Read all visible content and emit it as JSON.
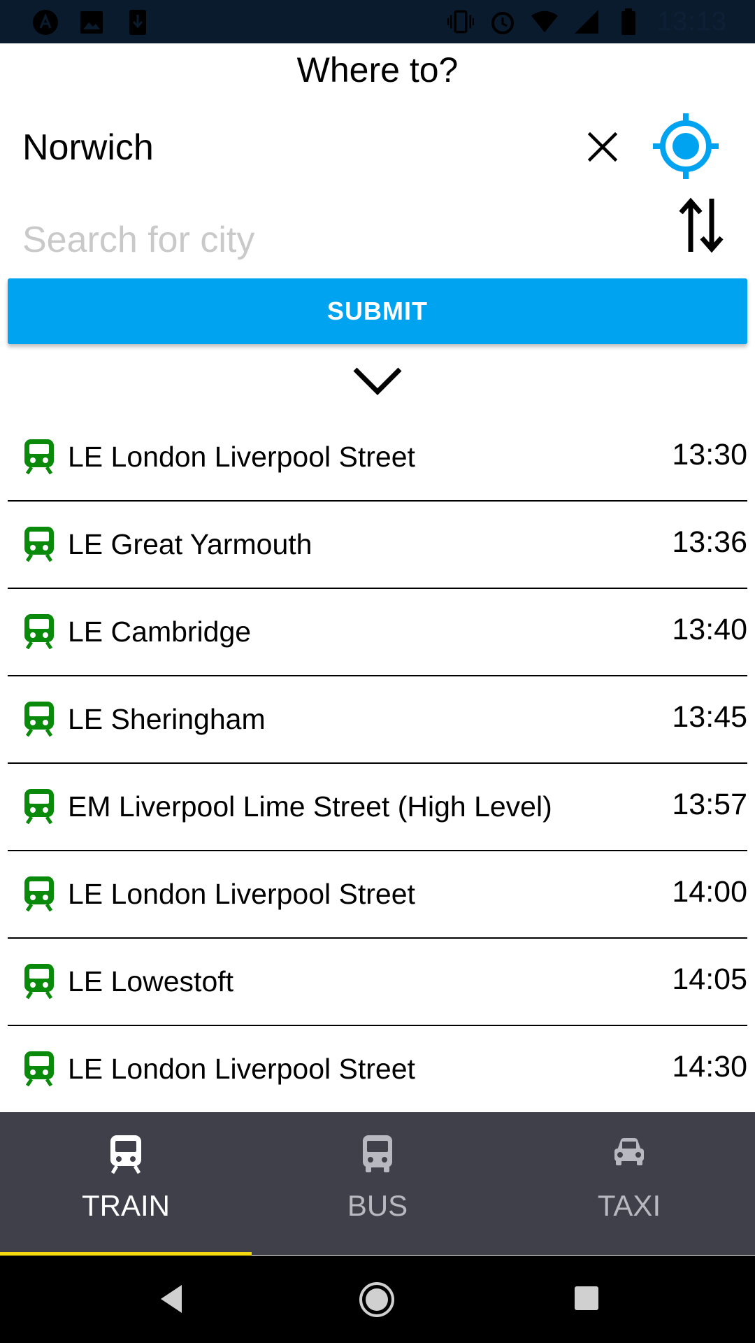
{
  "status_bar": {
    "time": "13:13",
    "left_icons": [
      "app-a-icon",
      "image-icon",
      "download-icon"
    ],
    "right_icons": [
      "vibrate-icon",
      "alarm-icon",
      "wifi-icon",
      "signal-icon",
      "battery-icon"
    ]
  },
  "header": {
    "title": "Where to?",
    "from_value": "Norwich",
    "to_placeholder": "Search for city",
    "submit_label": "SUBMIT"
  },
  "departures": [
    {
      "operator": "LE",
      "destination": "LE London Liverpool Street",
      "time": "13:30"
    },
    {
      "operator": "LE",
      "destination": "LE Great Yarmouth",
      "time": "13:36"
    },
    {
      "operator": "LE",
      "destination": "LE Cambridge",
      "time": "13:40"
    },
    {
      "operator": "LE",
      "destination": "LE Sheringham",
      "time": "13:45"
    },
    {
      "operator": "EM",
      "destination": "EM Liverpool Lime Street (High Level)",
      "time": "13:57"
    },
    {
      "operator": "LE",
      "destination": "LE London Liverpool Street",
      "time": "14:00"
    },
    {
      "operator": "LE",
      "destination": "LE Lowestoft",
      "time": "14:05"
    },
    {
      "operator": "LE",
      "destination": "LE London Liverpool Street",
      "time": "14:30"
    }
  ],
  "tabs": [
    {
      "label": "TRAIN",
      "icon": "train-icon",
      "active": true
    },
    {
      "label": "BUS",
      "icon": "bus-icon",
      "active": false
    },
    {
      "label": "TAXI",
      "icon": "car-icon",
      "active": false
    }
  ],
  "colors": {
    "accent": "#00a3f0",
    "train_icon": "#0a8a0a",
    "tabbar": "#3f4049",
    "tab_indicator": "#f5d80f",
    "status_bar": "#0b1b2e"
  }
}
